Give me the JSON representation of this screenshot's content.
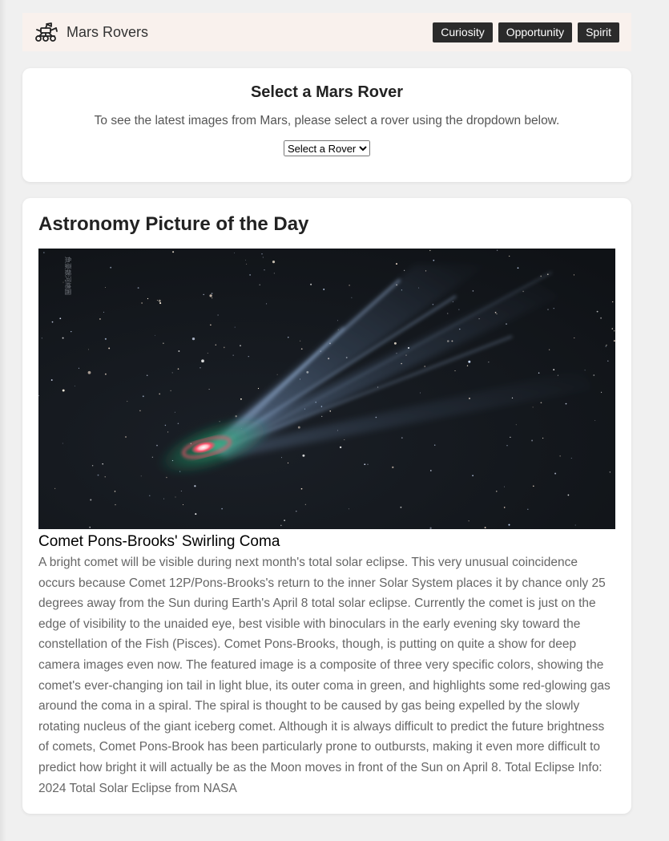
{
  "navbar": {
    "brand": "Mars Rovers",
    "brand_icon": "rover-icon",
    "links": [
      "Curiosity",
      "Opportunity",
      "Spirit"
    ]
  },
  "selector": {
    "title": "Select a Mars Rover",
    "description": "To see the latest images from Mars, please select a rover using the dropdown below.",
    "dropdown_value": "Select a Rover"
  },
  "apod": {
    "heading": "Astronomy Picture of the Day",
    "image_watermark": "魚豪銀河總圓",
    "title": "Comet Pons-Brooks' Swirling Coma",
    "explanation": "A bright comet will be visible during next month's total solar eclipse. This very unusual coincidence occurs because Comet 12P/Pons-Brooks's return to the inner Solar System places it by chance only 25 degrees away from the Sun during Earth's April 8 total solar eclipse. Currently the comet is just on the edge of visibility to the unaided eye, best visible with binoculars in the early evening sky toward the constellation of the Fish (Pisces). Comet Pons-Brooks, though, is putting on quite a show for deep camera images even now. The featured image is a composite of three very specific colors, showing the comet's ever-changing ion tail in light blue, its outer coma in green, and highlights some red-glowing gas around the coma in a spiral. The spiral is thought to be caused by gas being expelled by the slowly rotating nucleus of the giant iceberg comet. Although it is always difficult to predict the future brightness of comets, Comet Pons-Brook has been particularly prone to outbursts, making it even more difficult to predict how bright it will actually be as the Moon moves in front of the Sun on April 8. Total Eclipse Info: 2024 Total Solar Eclipse from NASA"
  },
  "colors": {
    "page_bg": "#f0f0f0",
    "navbar_bg": "#f9f1ed",
    "nav_button_bg": "#2b2b2b",
    "card_bg": "#ffffff",
    "comet_tail": "#6f8fb8",
    "comet_coma": "#1f8f63",
    "comet_core": "#ff4f6a"
  }
}
